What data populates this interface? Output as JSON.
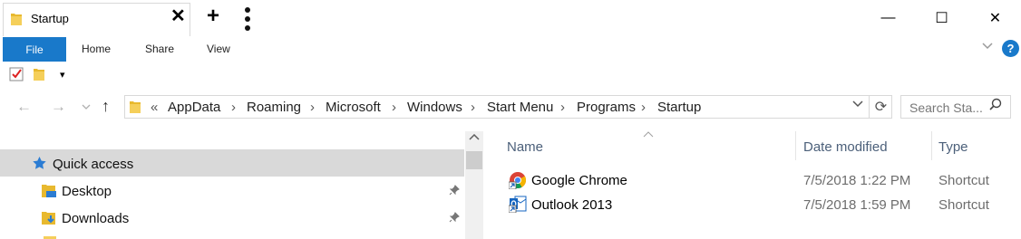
{
  "window": {
    "tab_title": "Startup",
    "tab_close": "✕",
    "new_tab": "+",
    "minimize": "—",
    "maximize": "☐",
    "close": "✕"
  },
  "ribbon": {
    "tabs": [
      "File",
      "Home",
      "Share",
      "View"
    ],
    "help": "?"
  },
  "quick_access_toolbar": {
    "dropdown": "▾"
  },
  "address": {
    "breadcrumbs": [
      "AppData",
      "Roaming",
      "Microsoft",
      "Windows",
      "Start Menu",
      "Programs",
      "Startup"
    ],
    "overflow": "«",
    "separator": "›",
    "search_placeholder": "Search Sta..."
  },
  "nav_pane": {
    "items": [
      {
        "label": "Quick access",
        "icon": "star-icon",
        "selected": true
      },
      {
        "label": "Desktop",
        "icon": "desktop-folder-icon",
        "pinned": true
      },
      {
        "label": "Downloads",
        "icon": "downloads-folder-icon",
        "pinned": true
      }
    ]
  },
  "file_list": {
    "columns": [
      "Name",
      "Date modified",
      "Type"
    ],
    "rows": [
      {
        "name": "Google Chrome",
        "date": "7/5/2018 1:22 PM",
        "type": "Shortcut",
        "icon": "chrome-icon"
      },
      {
        "name": "Outlook 2013",
        "date": "7/5/2018 1:59 PM",
        "type": "Shortcut",
        "icon": "outlook-icon"
      }
    ]
  },
  "colors": {
    "accent": "#1979ca",
    "selected_row": "#d9d9d9",
    "column_header_text": "#4c607a"
  }
}
